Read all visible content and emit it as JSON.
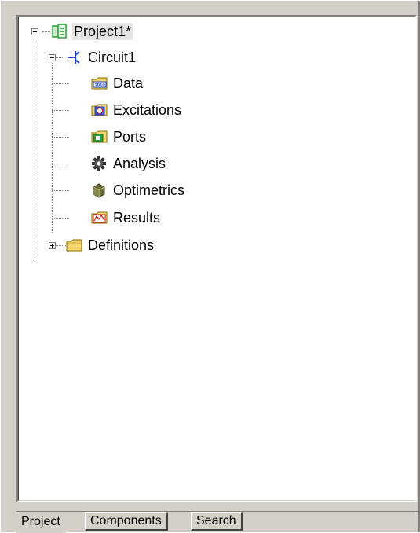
{
  "tree": {
    "project": {
      "label": "Project1*",
      "icon": "project-icon",
      "expanded": true,
      "selected": true
    },
    "circuit": {
      "label": "Circuit1",
      "icon": "circuit-icon",
      "expanded": true
    },
    "circuit_children": [
      {
        "label": "Data",
        "icon": "data-folder-icon"
      },
      {
        "label": "Excitations",
        "icon": "excitations-folder-icon"
      },
      {
        "label": "Ports",
        "icon": "ports-folder-icon"
      },
      {
        "label": "Analysis",
        "icon": "analysis-gear-icon"
      },
      {
        "label": "Optimetrics",
        "icon": "optimetrics-icon"
      },
      {
        "label": "Results",
        "icon": "results-folder-icon"
      }
    ],
    "definitions": {
      "label": "Definitions",
      "icon": "folder-icon",
      "expanded": false
    }
  },
  "tabs": [
    {
      "label": "Project",
      "active": true
    },
    {
      "label": "Components",
      "active": false
    },
    {
      "label": "Search",
      "active": false
    }
  ],
  "colors": {
    "panel_bg": "#d4d0c8",
    "tree_bg": "#ffffff",
    "folder_yellow": "#f5d76e",
    "project_green": "#2e9e3a",
    "circuit_blue": "#1a3fd6"
  }
}
